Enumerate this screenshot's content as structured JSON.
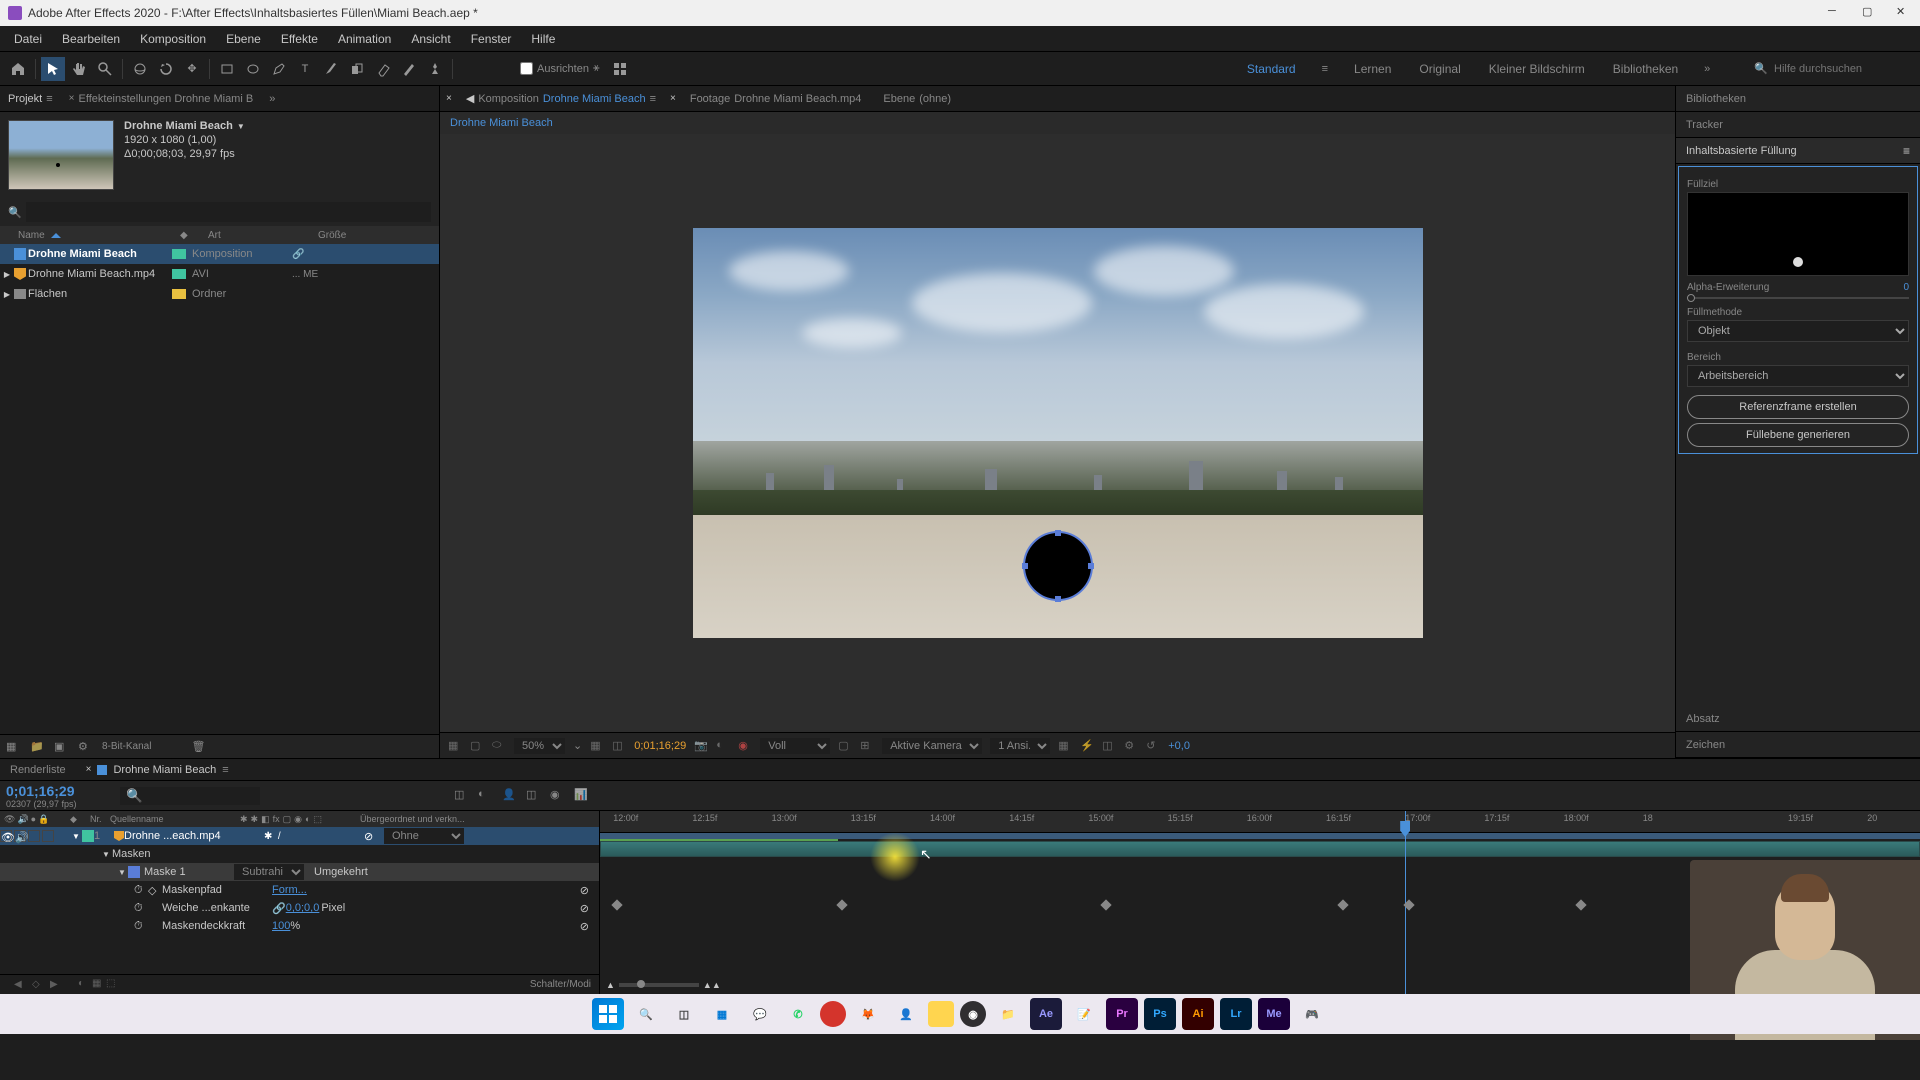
{
  "app": {
    "title": "Adobe After Effects 2020 - F:\\After Effects\\Inhaltsbasiertes Füllen\\Miami Beach.aep *"
  },
  "menus": [
    "Datei",
    "Bearbeiten",
    "Komposition",
    "Ebene",
    "Effekte",
    "Animation",
    "Ansicht",
    "Fenster",
    "Hilfe"
  ],
  "toolbar": {
    "align_label": "Ausrichten",
    "workspaces": [
      "Standard",
      "Lernen",
      "Original",
      "Kleiner Bildschirm",
      "Bibliotheken"
    ],
    "active_workspace": "Standard",
    "search_placeholder": "Hilfe durchsuchen"
  },
  "project_panel": {
    "tab_project": "Projekt",
    "tab_effect": "Effekteinstellungen Drohne Miami B",
    "comp_name": "Drohne Miami Beach",
    "resolution": "1920 x 1080 (1,00)",
    "duration_fps": "Δ0;00;08;03, 29,97 fps",
    "headers": {
      "name": "Name",
      "art": "Art",
      "groesse": "Größe"
    },
    "items": [
      {
        "name": "Drohne Miami Beach",
        "art": "Komposition",
        "attr": "",
        "tag": "teal",
        "icon": "comp",
        "sel": true
      },
      {
        "name": "Drohne Miami Beach.mp4",
        "art": "AVI",
        "attr": "... ME",
        "tag": "teal",
        "icon": "footage",
        "sel": false
      },
      {
        "name": "Flächen",
        "art": "Ordner",
        "attr": "",
        "tag": "yellow",
        "icon": "folder",
        "sel": false
      }
    ],
    "footer_channel": "8-Bit-Kanal"
  },
  "viewer": {
    "tab_composition": "Komposition",
    "tab_composition_name": "Drohne Miami Beach",
    "tab_footage": "Footage",
    "tab_footage_name": "Drohne Miami Beach.mp4",
    "tab_layer": "Ebene",
    "tab_layer_name": "(ohne)",
    "locator": "Drohne Miami Beach",
    "zoom": "50%",
    "timecode": "0;01;16;29",
    "resolution": "Voll",
    "camera": "Aktive Kamera",
    "views": "1 Ansi...",
    "exposure": "+0,0"
  },
  "right_panel": {
    "tab_libraries": "Bibliotheken",
    "tab_tracker": "Tracker",
    "tab_caf": "Inhaltsbasierte Füllung",
    "fill_target": "Füllziel",
    "alpha_expand": "Alpha-Erweiterung",
    "alpha_expand_value": "0",
    "fill_method": "Füllmethode",
    "fill_method_value": "Objekt",
    "range": "Bereich",
    "range_value": "Arbeitsbereich",
    "btn_reference": "Referenzframe erstellen",
    "btn_generate": "Füllebene generieren",
    "tab_absatz": "Absatz",
    "tab_zeichen": "Zeichen"
  },
  "timeline": {
    "tab_render": "Renderliste",
    "tab_comp": "Drohne Miami Beach",
    "timecode": "0;01;16;29",
    "frame_info": "02307 (29,97 fps)",
    "col_nr": "Nr.",
    "col_source": "Quellenname",
    "col_parent": "Übergeordnet und verkn...",
    "layer": {
      "nr": "1",
      "name": "Drohne ...each.mp4",
      "parent": "Ohne",
      "masks_group": "Masken",
      "mask_name": "Maske 1",
      "mask_mode": "Subtrahi...",
      "mask_inverted": "Umgekehrt",
      "props": {
        "path": "Maskenpfad",
        "path_value": "Form...",
        "feather": "Weiche ...enkante",
        "feather_value": "0,0;0,0",
        "feather_unit": "Pixel",
        "opacity": "Maskendeckkraft",
        "opacity_value": "100",
        "opacity_unit": "%"
      }
    },
    "ticks": [
      "12:00f",
      "12:15f",
      "13:00f",
      "13:15f",
      "14:00f",
      "14:15f",
      "15:00f",
      "15:15f",
      "16:00f",
      "16:15f",
      "17:00f",
      "17:15f",
      "18:00f",
      "18",
      "19:15f",
      "20"
    ],
    "footer_modes": "Schalter/Modi"
  },
  "taskbar": {
    "icons": [
      "win",
      "search",
      "tasks",
      "widget",
      "teams",
      "whatsapp",
      "red",
      "firefox",
      "human",
      "notes",
      "obs",
      "files",
      "ae",
      "notepad",
      "pr",
      "ps",
      "ai",
      "lr",
      "me",
      "game"
    ]
  }
}
